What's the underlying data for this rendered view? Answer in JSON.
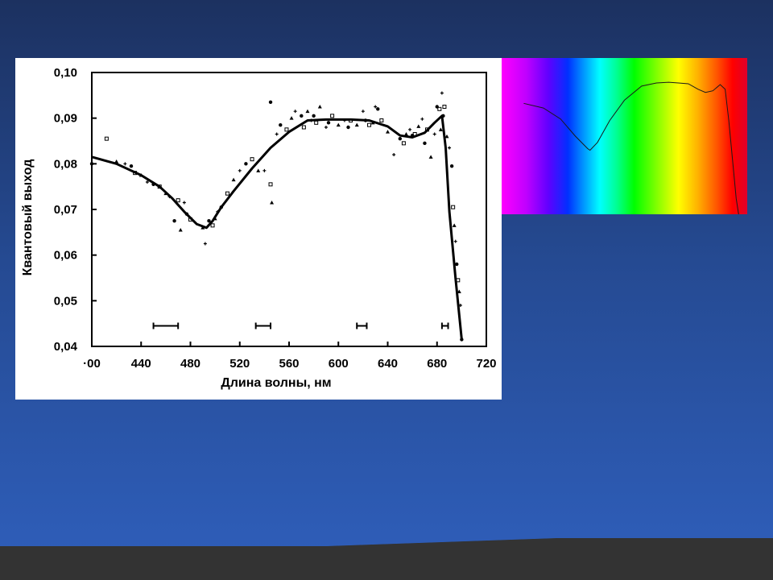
{
  "colors": {
    "slide_top": "#1c3160",
    "slide_bottom": "#2f5fbc",
    "footer_bar": "#333333"
  },
  "chart_data": [
    {
      "type": "scatter",
      "title": "",
      "xlabel": "Длина волны, нм",
      "ylabel": "Квантовый выход",
      "x_tick_labels": [
        "·00",
        "440",
        "480",
        "520",
        "560",
        "600",
        "640",
        "680",
        "720"
      ],
      "x_ticks": [
        400,
        440,
        480,
        520,
        560,
        600,
        640,
        680,
        720
      ],
      "y_tick_labels": [
        "0,10",
        "0,09",
        "0,08",
        "0,07",
        "0,06",
        "0,05",
        "0,04"
      ],
      "y_ticks": [
        0.1,
        0.09,
        0.08,
        0.07,
        0.06,
        0.05,
        0.04
      ],
      "xlim": [
        400,
        700
      ],
      "ylim": [
        0.04,
        0.1
      ],
      "grid": false,
      "series": [
        {
          "type": "line",
          "x": [
            400,
            420,
            440,
            455,
            465,
            475,
            485,
            493,
            498,
            505,
            515,
            530,
            545,
            560,
            575,
            590,
            610,
            625,
            640,
            650,
            660,
            670,
            678,
            684,
            687,
            690,
            695,
            700
          ],
          "y": [
            0.0815,
            0.08,
            0.0775,
            0.075,
            0.0725,
            0.0695,
            0.0668,
            0.066,
            0.0675,
            0.0705,
            0.074,
            0.079,
            0.0835,
            0.087,
            0.0895,
            0.0897,
            0.0897,
            0.0895,
            0.0882,
            0.0862,
            0.0858,
            0.0868,
            0.089,
            0.0905,
            0.0835,
            0.0695,
            0.055,
            0.0415
          ]
        },
        {
          "type": "scatter",
          "x": [
            400,
            412,
            420,
            427,
            432,
            435,
            440,
            445,
            450,
            455,
            460,
            463,
            467,
            470,
            472,
            475,
            477,
            480,
            490,
            492,
            495,
            498,
            500,
            502,
            505,
            510,
            515,
            520,
            525,
            530,
            535,
            540,
            545,
            545,
            546,
            550,
            553,
            558,
            562,
            565,
            570,
            572,
            575,
            578,
            580,
            582,
            585,
            590,
            592,
            595,
            600,
            605,
            608,
            610,
            615,
            620,
            622,
            625,
            628,
            630,
            632,
            635,
            640,
            645,
            650,
            653,
            655,
            658,
            660,
            662,
            665,
            668,
            670,
            672,
            675,
            678,
            680,
            682,
            683,
            684,
            685,
            686,
            688,
            690,
            692,
            693,
            694,
            695,
            696,
            697,
            698,
            699,
            700
          ],
          "y": [
            0.08,
            0.0855,
            0.0805,
            0.08,
            0.0795,
            0.078,
            0.0775,
            0.076,
            0.0755,
            0.075,
            0.0735,
            0.0728,
            0.0675,
            0.072,
            0.0655,
            0.0715,
            0.069,
            0.0678,
            0.066,
            0.0625,
            0.0675,
            0.0665,
            0.068,
            0.0695,
            0.0705,
            0.0735,
            0.0765,
            0.0785,
            0.08,
            0.081,
            0.0785,
            0.0785,
            0.0935,
            0.0755,
            0.0715,
            0.0865,
            0.0885,
            0.0875,
            0.09,
            0.0915,
            0.0905,
            0.088,
            0.0915,
            0.0895,
            0.0905,
            0.089,
            0.0925,
            0.088,
            0.089,
            0.0905,
            0.0885,
            0.0895,
            0.088,
            0.0895,
            0.0885,
            0.0915,
            0.0895,
            0.0885,
            0.089,
            0.0925,
            0.092,
            0.0895,
            0.087,
            0.082,
            0.0855,
            0.0845,
            0.0865,
            0.0875,
            0.0862,
            0.0865,
            0.0882,
            0.0898,
            0.0845,
            0.0875,
            0.0815,
            0.0865,
            0.0925,
            0.092,
            0.0875,
            0.0955,
            0.0905,
            0.0925,
            0.086,
            0.0835,
            0.0795,
            0.0705,
            0.0665,
            0.063,
            0.058,
            0.0545,
            0.052,
            0.049,
            0.0415
          ]
        }
      ],
      "error_bars": [
        {
          "x_min": 450,
          "x_max": 470,
          "y": 0.0445
        },
        {
          "x_min": 533,
          "x_max": 545,
          "y": 0.0445
        },
        {
          "x_min": 615,
          "x_max": 623,
          "y": 0.0445
        },
        {
          "x_min": 684,
          "x_max": 689,
          "y": 0.0445
        }
      ]
    },
    {
      "type": "line",
      "title": "",
      "background": "visible spectrum gradient (violet to red)",
      "x_fraction": [
        0.09,
        0.17,
        0.24,
        0.3,
        0.35,
        0.36,
        0.39,
        0.44,
        0.5,
        0.57,
        0.63,
        0.68,
        0.72,
        0.76,
        0.8,
        0.83,
        0.86,
        0.89,
        0.91,
        0.925,
        0.94,
        0.955,
        0.965
      ],
      "y_fraction": [
        0.29,
        0.32,
        0.39,
        0.5,
        0.58,
        0.59,
        0.54,
        0.4,
        0.27,
        0.18,
        0.16,
        0.155,
        0.16,
        0.165,
        0.2,
        0.22,
        0.21,
        0.17,
        0.2,
        0.4,
        0.65,
        0.9,
        1.0
      ]
    }
  ]
}
